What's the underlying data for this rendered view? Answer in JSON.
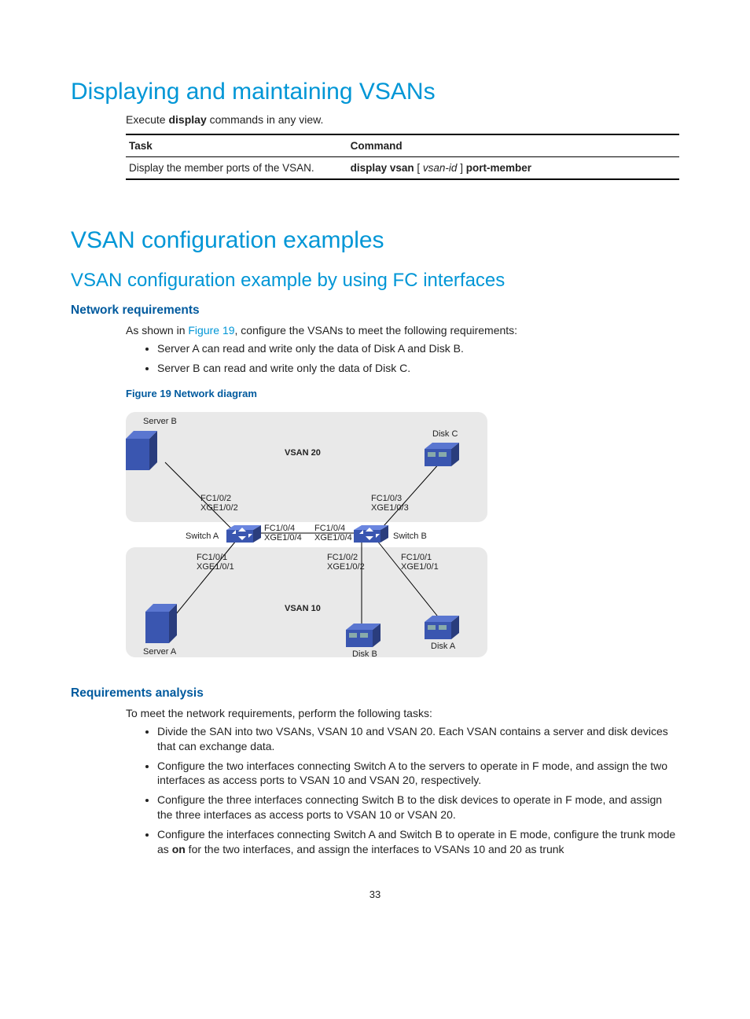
{
  "h1_display": "Displaying and maintaining VSANs",
  "exec_sentence_pre": "Execute ",
  "exec_sentence_bold": "display",
  "exec_sentence_post": " commands in any view.",
  "table": {
    "task_hdr": "Task",
    "cmd_hdr": "Command",
    "task_val": "Display the member ports of the VSAN.",
    "cmd_b1": "display vsan",
    "cmd_mid": " [ ",
    "cmd_it": "vsan-id",
    "cmd_mid2": " ] ",
    "cmd_b2": "port-member"
  },
  "h1_examples": "VSAN configuration examples",
  "h2_fc": "VSAN configuration example by using FC interfaces",
  "h3_netreq": "Network requirements",
  "netreq_intro_pre": "As shown in ",
  "netreq_intro_link": "Figure 19",
  "netreq_intro_post": ", configure the VSANs to meet the following requirements:",
  "netreq_b1": "Server A can read and write only the data of Disk A and Disk B.",
  "netreq_b2": "Server B can read and write only the data of Disk C.",
  "figcap": "Figure 19 Network diagram",
  "diagram": {
    "serverB": "Server B",
    "diskC": "Disk C",
    "vsan20": "VSAN 20",
    "fc102": "FC1/0/2",
    "xge102": "XGE1/0/2",
    "fc103": "FC1/0/3",
    "xge103": "XGE1/0/3",
    "switchA": "Switch A",
    "switchB": "Switch B",
    "fc104a": "FC1/0/4",
    "xge104a": "XGE1/0/4",
    "fc104b": "FC1/0/4",
    "xge104b": "XGE1/0/4",
    "fc101a": "FC1/0/1",
    "xge101a": "XGE1/0/1",
    "fc102b": "FC1/0/2",
    "xge102b": "XGE1/0/2",
    "fc101b": "FC1/0/1",
    "xge101b": "XGE1/0/1",
    "vsan10": "VSAN 10",
    "serverA": "Server A",
    "diskB": "Disk B",
    "diskA": "Disk A"
  },
  "h3_reqan": "Requirements analysis",
  "reqan_intro": "To meet the network requirements, perform the following tasks:",
  "reqan_b1": "Divide the SAN into two VSANs, VSAN 10 and VSAN 20. Each VSAN contains a server and disk devices that can exchange data.",
  "reqan_b2": "Configure the two interfaces connecting Switch A to the servers to operate in F mode, and assign the two interfaces as access ports to VSAN 10 and VSAN 20, respectively.",
  "reqan_b3": "Configure the three interfaces connecting Switch B to the disk devices to operate in F mode, and assign the three interfaces as access ports to VSAN 10 or VSAN 20.",
  "reqan_b4_pre": "Configure the interfaces connecting Switch A and Switch B to operate in E mode, configure the trunk mode as ",
  "reqan_b4_bold": "on",
  "reqan_b4_post": " for the two interfaces, and assign the interfaces to VSANs 10 and 20 as trunk",
  "pagenum": "33"
}
